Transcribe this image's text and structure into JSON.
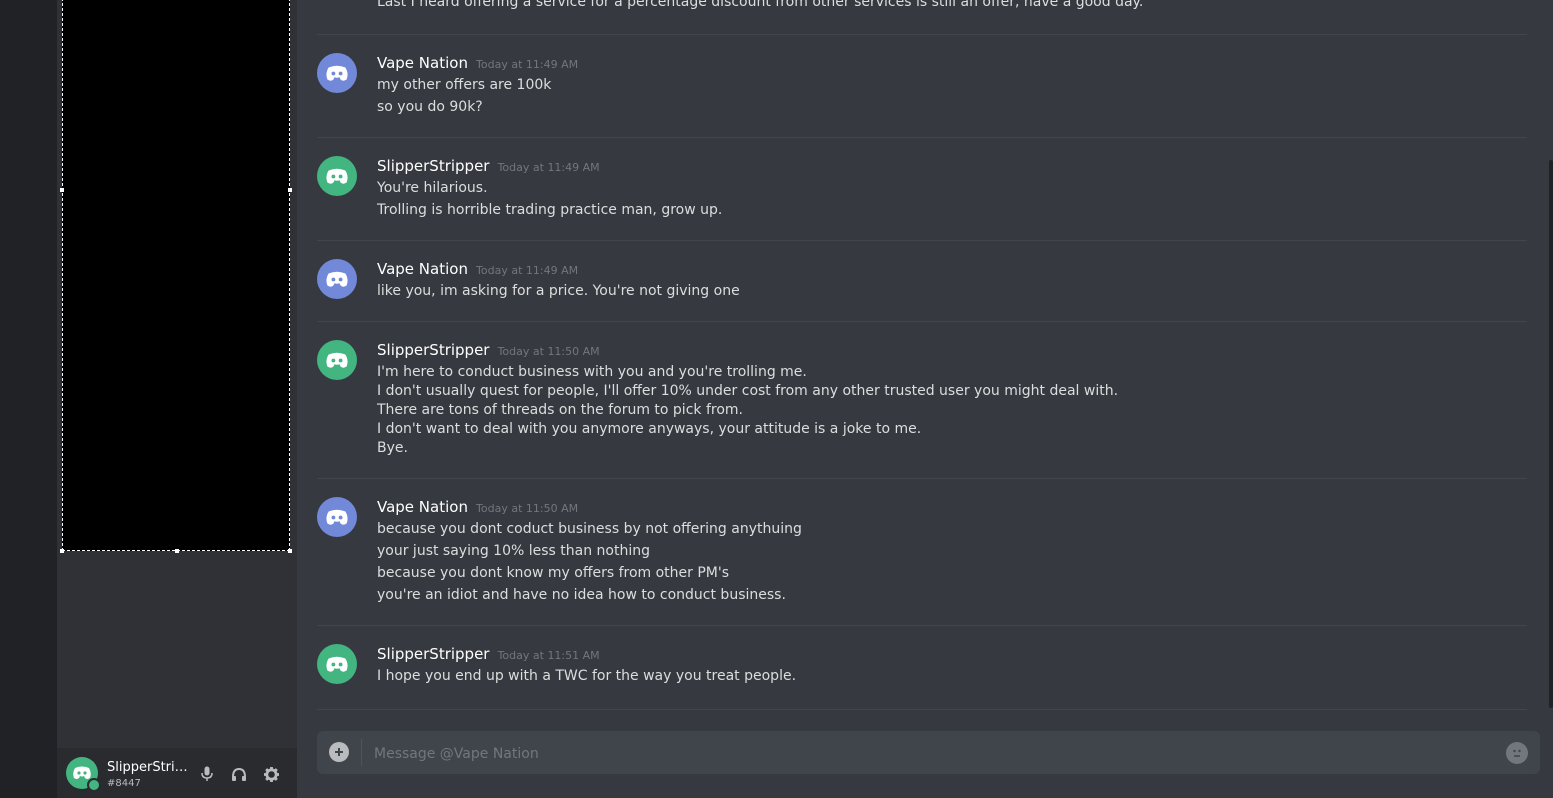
{
  "colors": {
    "blurple": "#7289da",
    "green": "#43b581",
    "background": "#36393f",
    "sidebar": "#2f3136"
  },
  "user_panel": {
    "name": "SlipperStripp...",
    "tag": "#8447",
    "status": "online",
    "icons": [
      "microphone-icon",
      "headphones-icon",
      "settings-gear-icon"
    ]
  },
  "messages": {
    "partial_line": "Last I heard offering a service for a percentage discount from other services is still an offer, have a good day.",
    "groups": [
      {
        "author": "Vape Nation",
        "timestamp": "Today at 11:49 AM",
        "avatar": "blurple",
        "lines": [
          "my other offers are 100k",
          "so you do 90k?"
        ]
      },
      {
        "author": "SlipperStripper",
        "timestamp": "Today at 11:49 AM",
        "avatar": "green",
        "lines": [
          "You're hilarious.",
          "Trolling is horrible trading practice man, grow up."
        ]
      },
      {
        "author": "Vape Nation",
        "timestamp": "Today at 11:49 AM",
        "avatar": "blurple",
        "lines": [
          "like you, im asking for a price. You're not giving one"
        ]
      },
      {
        "author": "SlipperStripper",
        "timestamp": "Today at 11:50 AM",
        "avatar": "green",
        "lines": [
          "I'm here to conduct business with you and you're trolling me.",
          "I don't usually quest for people, I'll offer 10% under cost from any other trusted user you might deal with.",
          "There are tons of threads on the forum to pick from.",
          "I don't want to deal with you anymore anyways, your attitude is a joke to me.",
          "Bye."
        ]
      },
      {
        "author": "Vape Nation",
        "timestamp": "Today at 11:50 AM",
        "avatar": "blurple",
        "lines": [
          "because you dont coduct business by not offering anythuing",
          "your just saying 10% less than nothing",
          "because you dont know my offers from other PM's",
          "you're an idiot and have no idea how to conduct business."
        ]
      },
      {
        "author": "SlipperStripper",
        "timestamp": "Today at 11:51 AM",
        "avatar": "green",
        "lines": [
          "I hope you end up with a TWC for the way you treat people."
        ]
      }
    ]
  },
  "composer": {
    "placeholder": "Message @Vape Nation",
    "value": ""
  }
}
